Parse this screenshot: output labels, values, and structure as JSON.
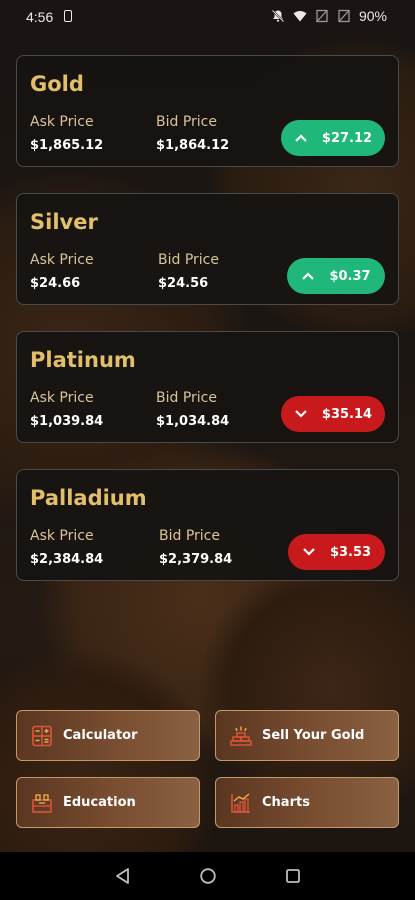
{
  "status_bar": {
    "time": "4:56",
    "battery": "90%"
  },
  "metals": [
    {
      "name": "Gold",
      "ask_label": "Ask Price",
      "ask": "$1,865.12",
      "bid_label": "Bid Price",
      "bid": "$1,864.12",
      "change": "$27.12",
      "direction": "up"
    },
    {
      "name": "Silver",
      "ask_label": "Ask Price",
      "ask": "$24.66",
      "bid_label": "Bid Price",
      "bid": "$24.56",
      "change": "$0.37",
      "direction": "up"
    },
    {
      "name": "Platinum",
      "ask_label": "Ask Price",
      "ask": "$1,039.84",
      "bid_label": "Bid Price",
      "bid": "$1,034.84",
      "change": "$35.14",
      "direction": "down"
    },
    {
      "name": "Palladium",
      "ask_label": "Ask Price",
      "ask": "$2,384.84",
      "bid_label": "Bid Price",
      "bid": "$2,379.84",
      "change": "$3.53",
      "direction": "down"
    }
  ],
  "quick_actions": [
    {
      "label": "Calculator",
      "icon": "calculator-icon"
    },
    {
      "label": "Sell Your Gold",
      "icon": "gold-bars-icon"
    },
    {
      "label": "Education",
      "icon": "education-icon"
    },
    {
      "label": "Charts",
      "icon": "chart-icon"
    }
  ],
  "colors": {
    "title_gold": "#e2c06b",
    "up_green": "#1fb77a",
    "down_red": "#c81a1c",
    "button_border": "#c19a6b"
  }
}
